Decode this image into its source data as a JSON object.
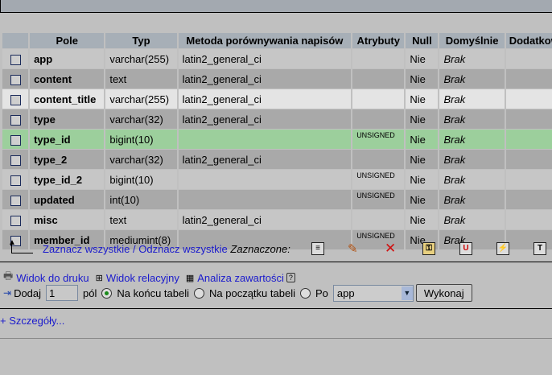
{
  "columns": [
    "Pole",
    "Typ",
    "Metoda porównywania napisów",
    "Atrybuty",
    "Null",
    "Domyślnie",
    "Dodatkowo"
  ],
  "rows": [
    {
      "field": "app",
      "type": "varchar(255)",
      "collation": "latin2_general_ci",
      "attr": "",
      "null": "Nie",
      "default": "Brak"
    },
    {
      "field": "content",
      "type": "text",
      "collation": "latin2_general_ci",
      "attr": "",
      "null": "Nie",
      "default": "Brak"
    },
    {
      "field": "content_title",
      "type": "varchar(255)",
      "collation": "latin2_general_ci",
      "attr": "",
      "null": "Nie",
      "default": "Brak"
    },
    {
      "field": "type",
      "type": "varchar(32)",
      "collation": "latin2_general_ci",
      "attr": "",
      "null": "Nie",
      "default": "Brak"
    },
    {
      "field": "type_id",
      "type": "bigint(10)",
      "collation": "",
      "attr": "UNSIGNED",
      "null": "Nie",
      "default": "Brak"
    },
    {
      "field": "type_2",
      "type": "varchar(32)",
      "collation": "latin2_general_ci",
      "attr": "",
      "null": "Nie",
      "default": "Brak"
    },
    {
      "field": "type_id_2",
      "type": "bigint(10)",
      "collation": "",
      "attr": "UNSIGNED",
      "null": "Nie",
      "default": "Brak"
    },
    {
      "field": "updated",
      "type": "int(10)",
      "collation": "",
      "attr": "UNSIGNED",
      "null": "Nie",
      "default": "Brak"
    },
    {
      "field": "misc",
      "type": "text",
      "collation": "latin2_general_ci",
      "attr": "",
      "null": "Nie",
      "default": "Brak"
    },
    {
      "field": "member_id",
      "type": "mediumint(8)",
      "collation": "",
      "attr": "UNSIGNED",
      "null": "Nie",
      "default": "Brak"
    }
  ],
  "toolbar": {
    "select_all": "Zaznacz wszystkie",
    "separator": "/",
    "deselect_all": "Odznacz wszystkie",
    "with_selected": "Zaznaczone:"
  },
  "links": {
    "print": "Widok do druku",
    "relational": "Widok relacyjny",
    "analyze": "Analiza zawartości"
  },
  "add": {
    "label": "Dodaj",
    "count": "1",
    "fields": "pól",
    "at_end": "Na końcu tabeli",
    "at_start": "Na początku tabeli",
    "after": "Po",
    "after_value": "app",
    "go": "Wykonaj"
  },
  "details": "+ Szczegóły..."
}
